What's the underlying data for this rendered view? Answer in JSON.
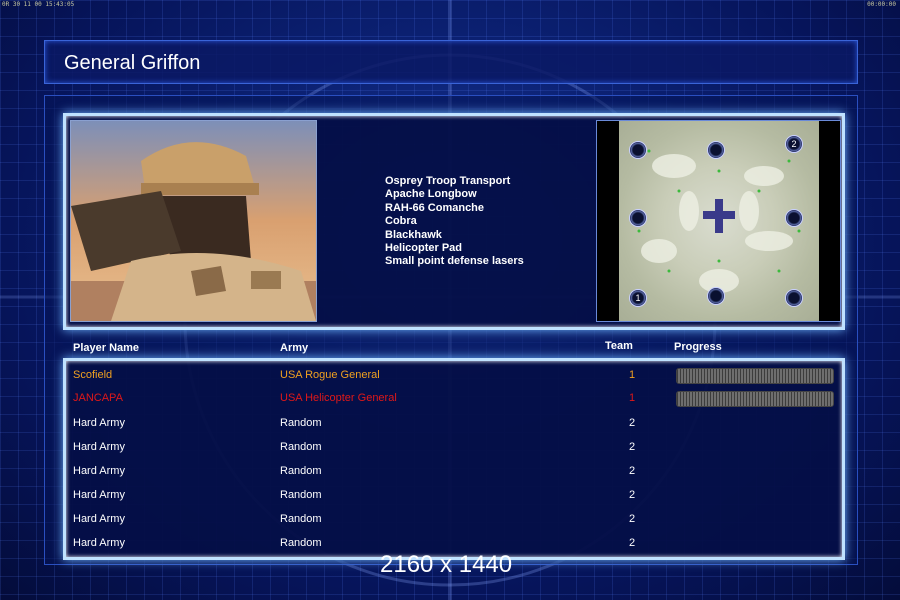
{
  "top_strip": {
    "left": "0R 30 11 00 15:43:05",
    "right": "00:00:00"
  },
  "header": {
    "title": "General Griffon"
  },
  "general": {
    "units": [
      "Osprey Troop Transport",
      "Apache Longbow",
      "RAH-66 Comanche",
      "Cobra",
      "Blackhawk",
      "Helicopter Pad",
      "Small point defense lasers"
    ]
  },
  "minimap": {
    "labels": {
      "spawn1": "1",
      "spawn2": "2"
    }
  },
  "table": {
    "headers": {
      "player": "Player Name",
      "army": "Army",
      "team": "Team",
      "progress": "Progress"
    },
    "rows": [
      {
        "name": "Scofield",
        "army": "USA Rogue General",
        "team": "1",
        "progress": 1.0,
        "color": "#f0a020"
      },
      {
        "name": "JANCAPA",
        "army": "USA Helicopter General",
        "team": "1",
        "progress": 1.0,
        "color": "#e01818"
      },
      {
        "name": "Hard Army",
        "army": "Random",
        "team": "2",
        "color": "#ffffff"
      },
      {
        "name": "Hard Army",
        "army": "Random",
        "team": "2",
        "color": "#ffffff"
      },
      {
        "name": "Hard Army",
        "army": "Random",
        "team": "2",
        "color": "#ffffff"
      },
      {
        "name": "Hard Army",
        "army": "Random",
        "team": "2",
        "color": "#ffffff"
      },
      {
        "name": "Hard Army",
        "army": "Random",
        "team": "2",
        "color": "#ffffff"
      },
      {
        "name": "Hard Army",
        "army": "Random",
        "team": "2",
        "color": "#ffffff"
      }
    ]
  },
  "watermark": "2160 x 1440",
  "colors": {
    "panel_border": "#bfe2ff",
    "background": "#071448"
  }
}
